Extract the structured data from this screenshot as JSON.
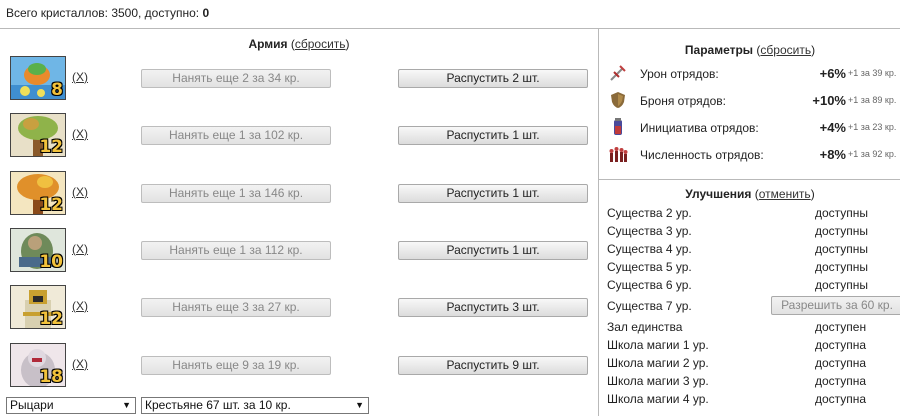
{
  "summary": {
    "label": "Всего кристаллов: 3500, доступно: ",
    "available": "0"
  },
  "army": {
    "title": "Армия",
    "reset": "сбросить",
    "units": [
      {
        "icon": "unit-portrait-1",
        "count": "8",
        "remove": "X",
        "hire": "Нанять еще 2 за 34 кр.",
        "dismiss": "Распустить 2 шт."
      },
      {
        "icon": "unit-portrait-2",
        "count": "12",
        "remove": "X",
        "hire": "Нанять еще 1 за 102 кр.",
        "dismiss": "Распустить 1 шт."
      },
      {
        "icon": "unit-portrait-3",
        "count": "12",
        "remove": "X",
        "hire": "Нанять еще 1 за 146 кр.",
        "dismiss": "Распустить 1 шт."
      },
      {
        "icon": "unit-portrait-4",
        "count": "10",
        "remove": "X",
        "hire": "Нанять еще 1 за 112 кр.",
        "dismiss": "Распустить 1 шт."
      },
      {
        "icon": "unit-portrait-5",
        "count": "12",
        "remove": "X",
        "hire": "Нанять еще 3 за 27 кр.",
        "dismiss": "Распустить 3 шт."
      },
      {
        "icon": "unit-portrait-6",
        "count": "18",
        "remove": "X",
        "hire": "Нанять еще 9 за 19 кр.",
        "dismiss": "Распустить 9 шт."
      }
    ],
    "faction_select": "Рыцари",
    "unit_select": "Крестьяне 67 шт. за 10 кр."
  },
  "params": {
    "title": "Параметры",
    "reset": "сбросить",
    "items": [
      {
        "icon": "sword-icon",
        "label": "Урон отрядов:",
        "value": "+6%",
        "cost": "+1 за 39 кр."
      },
      {
        "icon": "shield-icon",
        "label": "Броня отрядов:",
        "value": "+10%",
        "cost": "+1 за 89 кр."
      },
      {
        "icon": "potion-icon",
        "label": "Инициатива отрядов:",
        "value": "+4%",
        "cost": "+1 за 23 кр."
      },
      {
        "icon": "troops-icon",
        "label": "Численность отрядов:",
        "value": "+8%",
        "cost": "+1 за 92 кр."
      }
    ]
  },
  "upgrades": {
    "title": "Улучшения",
    "cancel": "отменить",
    "items": [
      {
        "name": "Существа 2 ур.",
        "status": "доступны"
      },
      {
        "name": "Существа 3 ур.",
        "status": "доступны"
      },
      {
        "name": "Существа 4 ур.",
        "status": "доступны"
      },
      {
        "name": "Существа 5 ур.",
        "status": "доступны"
      },
      {
        "name": "Существа 6 ур.",
        "status": "доступны"
      },
      {
        "name": "Существа 7 ур.",
        "status": ""
      },
      {
        "name": "Зал единства",
        "status": "доступен"
      },
      {
        "name": "Школа магии 1 ур.",
        "status": "доступна"
      },
      {
        "name": "Школа магии 2 ур.",
        "status": "доступна"
      },
      {
        "name": "Школа магии 3 ур.",
        "status": "доступна"
      },
      {
        "name": "Школа магии 4 ур.",
        "status": "доступна"
      }
    ],
    "allow_button": "Разрешить за 60 кр."
  }
}
